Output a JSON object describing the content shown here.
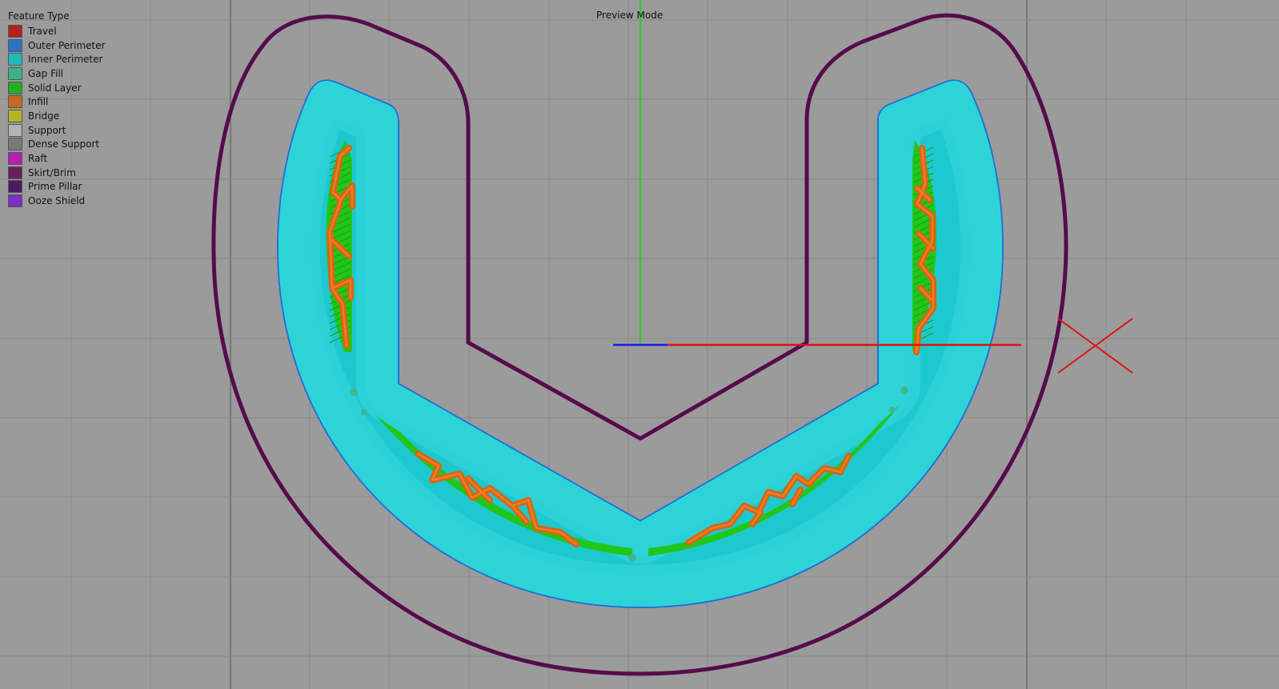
{
  "view": {
    "mode_label": "Preview Mode"
  },
  "legend": {
    "title": "Feature Type",
    "items": [
      {
        "label": "Travel",
        "color": "#b32121"
      },
      {
        "label": "Outer Perimeter",
        "color": "#2d72c2"
      },
      {
        "label": "Inner Perimeter",
        "color": "#21b8b8"
      },
      {
        "label": "Gap Fill",
        "color": "#3cb37e"
      },
      {
        "label": "Solid Layer",
        "color": "#21b021"
      },
      {
        "label": "Infill",
        "color": "#c4691f"
      },
      {
        "label": "Bridge",
        "color": "#b5b521"
      },
      {
        "label": "Support",
        "color": "#b3b3b3"
      },
      {
        "label": "Dense Support",
        "color": "#7a7a7a"
      },
      {
        "label": "Raft",
        "color": "#b321b3"
      },
      {
        "label": "Skirt/Brim",
        "color": "#6b1e5c"
      },
      {
        "label": "Prime Pillar",
        "color": "#4a1a63"
      },
      {
        "label": "Ooze Shield",
        "color": "#7a30c4"
      }
    ]
  },
  "colors": {
    "background": "#9b9b9b",
    "grid_minor": "#8a8a8a",
    "grid_major": "#6e6e6e",
    "axis_x": "#e01010",
    "axis_y": "#20d020",
    "axis_z": "#1020e0",
    "origin_marker": "#e01010",
    "skirt": "#560c4c",
    "outer_perimeter": "#1f6fd6",
    "inner_perimeter": "#1ec8cf",
    "inner_perimeter_light": "#55ecec",
    "solid_layer": "#22c61b",
    "infill": "#d9650e",
    "gap_fill": "#3fb88f"
  }
}
